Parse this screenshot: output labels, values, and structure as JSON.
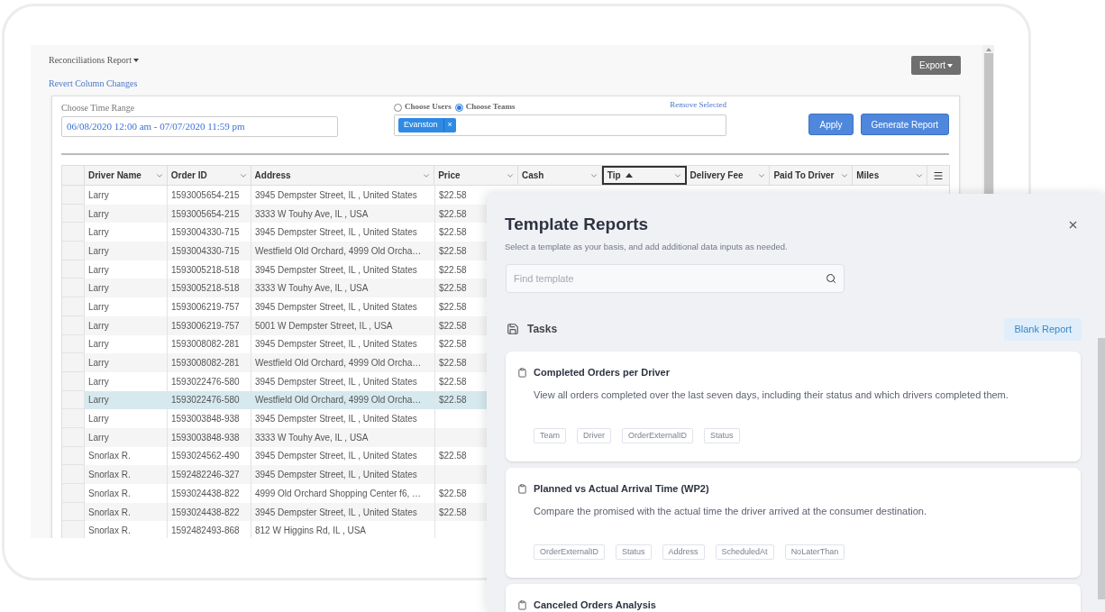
{
  "report": {
    "title": "Reconciliations Report",
    "revert_link": "Revert Column Changes",
    "export_button": "Export"
  },
  "filters": {
    "time_range_label": "Choose Time Range",
    "time_range_value": "06/08/2020 12:00 am - 07/07/2020 11:59 pm",
    "scope_options": [
      {
        "label": "Choose Users",
        "selected": false
      },
      {
        "label": "Choose Teams",
        "selected": true
      }
    ],
    "remove_link": "Remove Selected",
    "team_chips": [
      {
        "label": "Evanston",
        "remove": "×"
      }
    ],
    "buttons": [
      "Apply",
      "Generate Report"
    ]
  },
  "table": {
    "columns": [
      {
        "label": "Driver Name",
        "sorted": false
      },
      {
        "label": "Order ID",
        "sorted": false
      },
      {
        "label": "Address",
        "sorted": false
      },
      {
        "label": "Price",
        "sorted": false
      },
      {
        "label": "Cash",
        "sorted": false
      },
      {
        "label": "Tip",
        "sorted": true
      },
      {
        "label": "Delivery Fee",
        "sorted": false
      },
      {
        "label": "Paid To Driver",
        "sorted": false
      },
      {
        "label": "Miles",
        "sorted": false
      }
    ],
    "rows": [
      {
        "driver": "Larry",
        "order_id": "1593005654-215",
        "address": "3945 Dempster Street, IL , United States",
        "price": "$22.58",
        "selected": false
      },
      {
        "driver": "Larry",
        "order_id": "1593005654-215",
        "address": "3333 W Touhy Ave, IL , USA",
        "price": "$22.58",
        "selected": false
      },
      {
        "driver": "Larry",
        "order_id": "1593004330-715",
        "address": "3945 Dempster Street, IL , United States",
        "price": "$22.58",
        "selected": false
      },
      {
        "driver": "Larry",
        "order_id": "1593004330-715",
        "address": "Westfield Old Orchard, 4999 Old Orcha…",
        "price": "$22.58",
        "selected": false
      },
      {
        "driver": "Larry",
        "order_id": "1593005218-518",
        "address": "3945 Dempster Street, IL , United States",
        "price": "$22.58",
        "selected": false
      },
      {
        "driver": "Larry",
        "order_id": "1593005218-518",
        "address": "3333 W Touhy Ave, IL , USA",
        "price": "$22.58",
        "selected": false
      },
      {
        "driver": "Larry",
        "order_id": "1593006219-757",
        "address": "3945 Dempster Street, IL , United States",
        "price": "$22.58",
        "selected": false
      },
      {
        "driver": "Larry",
        "order_id": "1593006219-757",
        "address": "5001 W Dempster Street, IL , USA",
        "price": "$22.58",
        "selected": false
      },
      {
        "driver": "Larry",
        "order_id": "1593008082-281",
        "address": "3945 Dempster Street, IL , United States",
        "price": "$22.58",
        "selected": false
      },
      {
        "driver": "Larry",
        "order_id": "1593008082-281",
        "address": "Westfield Old Orchard, 4999 Old Orcha…",
        "price": "$22.58",
        "selected": false
      },
      {
        "driver": "Larry",
        "order_id": "1593022476-580",
        "address": "3945 Dempster Street, IL , United States",
        "price": "$22.58",
        "selected": false
      },
      {
        "driver": "Larry",
        "order_id": "1593022476-580",
        "address": "Westfield Old Orchard, 4999 Old Orcha…",
        "price": "$22.58",
        "selected": true
      },
      {
        "driver": "Larry",
        "order_id": "1593003848-938",
        "address": "3945 Dempster Street, IL , United States",
        "selected": false
      },
      {
        "driver": "Larry",
        "order_id": "1593003848-938",
        "address": "3333 W Touhy Ave, IL , USA",
        "selected": false
      },
      {
        "driver": "Snorlax R.",
        "order_id": "1593024562-490",
        "address": "3945 Dempster Street, IL , United States",
        "price": "$22.58",
        "selected": false
      },
      {
        "driver": "Snorlax R.",
        "order_id": "1592482246-327",
        "address": "3945 Dempster Street, IL , United States",
        "selected": false
      },
      {
        "driver": "Snorlax R.",
        "order_id": "1593024438-822",
        "address": "4999 Old Orchard Shopping Center f6, …",
        "price": "$22.58",
        "selected": false
      },
      {
        "driver": "Snorlax R.",
        "order_id": "1593024438-822",
        "address": "3945 Dempster Street, IL , United States",
        "price": "$22.58",
        "selected": false
      },
      {
        "driver": "Snorlax R.",
        "order_id": "1592482493-868",
        "address": "812 W Higgins Rd, IL , USA",
        "selected": false
      }
    ]
  },
  "template_panel": {
    "title": "Template Reports",
    "subtitle": "Select a template as your basis, and add additional data inputs as needed.",
    "search": {
      "placeholder": "Find template"
    },
    "section": {
      "title": "Tasks",
      "action": "Blank Report"
    },
    "templates": [
      {
        "title": "Completed Orders per Driver",
        "description": "View all orders completed over the last seven days, including their status and which drivers completed them.",
        "tags": [
          "Team",
          "Driver",
          "OrderExternalID",
          "Status"
        ]
      },
      {
        "title": "Planned vs Actual Arrival Time (WP2)",
        "description": "Compare the promised with the actual time the driver arrived at the consumer destination.",
        "tags": [
          "OrderExternalID",
          "Status",
          "Address",
          "ScheduledAt",
          "NoLaterThan"
        ]
      },
      {
        "title": "Canceled Orders Analysis"
      }
    ]
  }
}
